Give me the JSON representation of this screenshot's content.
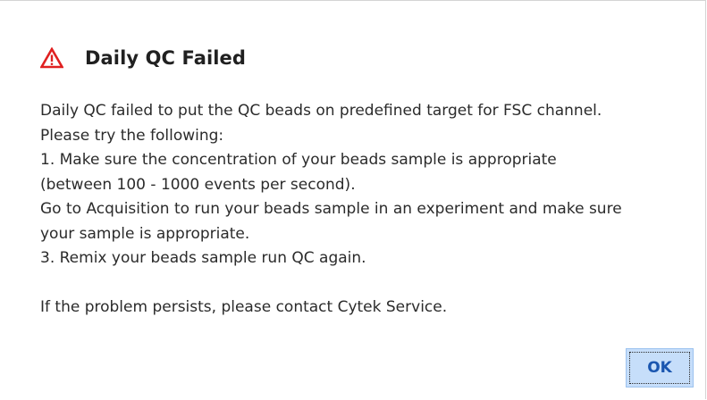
{
  "dialog": {
    "title": "Daily QC Failed",
    "icon": "warning-triangle-icon",
    "accent_color": "#e02020",
    "message_lines": [
      "Daily QC failed to put the QC beads on predefined target for FSC channel.",
      "Please try the following:",
      "1. Make sure the concentration of your beads sample is appropriate",
      "(between 100 - 1000 events per second).",
      "Go to Acquisition to run your beads sample in an experiment and make sure",
      "your sample is appropriate.",
      "3. Remix your beads sample run QC again."
    ],
    "footer_message": "If the problem persists, please contact Cytek Service.",
    "ok_label": "OK"
  }
}
